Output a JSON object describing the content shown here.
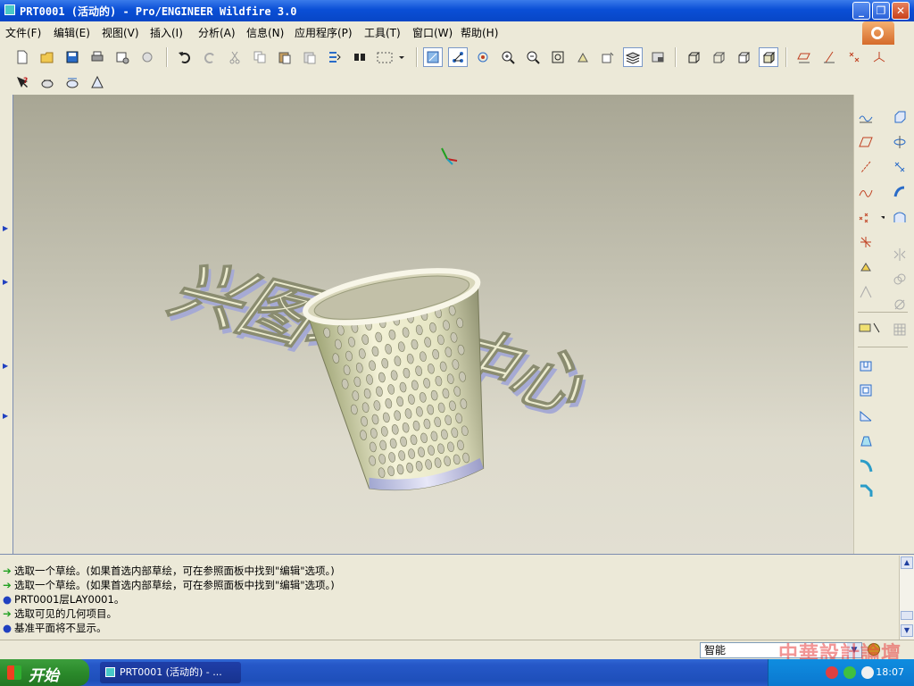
{
  "window": {
    "title": "PRT0001 (活动的) - Pro/ENGINEER Wildfire 3.0",
    "minimize": "_",
    "restore": "❐",
    "close": "✕"
  },
  "menu": [
    {
      "label": "文件(F)"
    },
    {
      "label": "编辑(E)"
    },
    {
      "label": "视图(V)"
    },
    {
      "label": "插入(I)"
    },
    {
      "label": "分析(A)"
    },
    {
      "label": "信息(N)"
    },
    {
      "label": "应用程序(P)"
    },
    {
      "label": "工具(T)"
    },
    {
      "label": "窗口(W)"
    },
    {
      "label": "帮助(H)"
    }
  ],
  "viewport": {
    "model_text": "兴图培训中心",
    "csys_x": "x",
    "csys_y": "y",
    "csys_z": "z"
  },
  "messages": [
    {
      "icon": "arrow",
      "text": "选取一个草绘。(如果首选内部草绘，可在参照面板中找到\"编辑\"选项。)"
    },
    {
      "icon": "arrow",
      "text": "选取一个草绘。(如果首选内部草绘，可在参照面板中找到\"编辑\"选项。)"
    },
    {
      "icon": "dot",
      "text": "PRT0001层LAY0001。"
    },
    {
      "icon": "arrow",
      "text": "选取可见的几何项目。"
    },
    {
      "icon": "dot",
      "text": "基准平面将不显示。"
    }
  ],
  "status": {
    "filter_value": "智能",
    "watermark": "中華設計論壇"
  },
  "taskbar": {
    "start_label": "开始",
    "task_label": "PRT0001 (活动的) - ...",
    "clock": "18:07"
  },
  "colors": {
    "title_blue": "#0a4fd6",
    "model_fill": "#e8e8c8",
    "model_shadow": "#a8acd8",
    "arrow_green": "#20a020",
    "dot_blue": "#2040c0"
  }
}
